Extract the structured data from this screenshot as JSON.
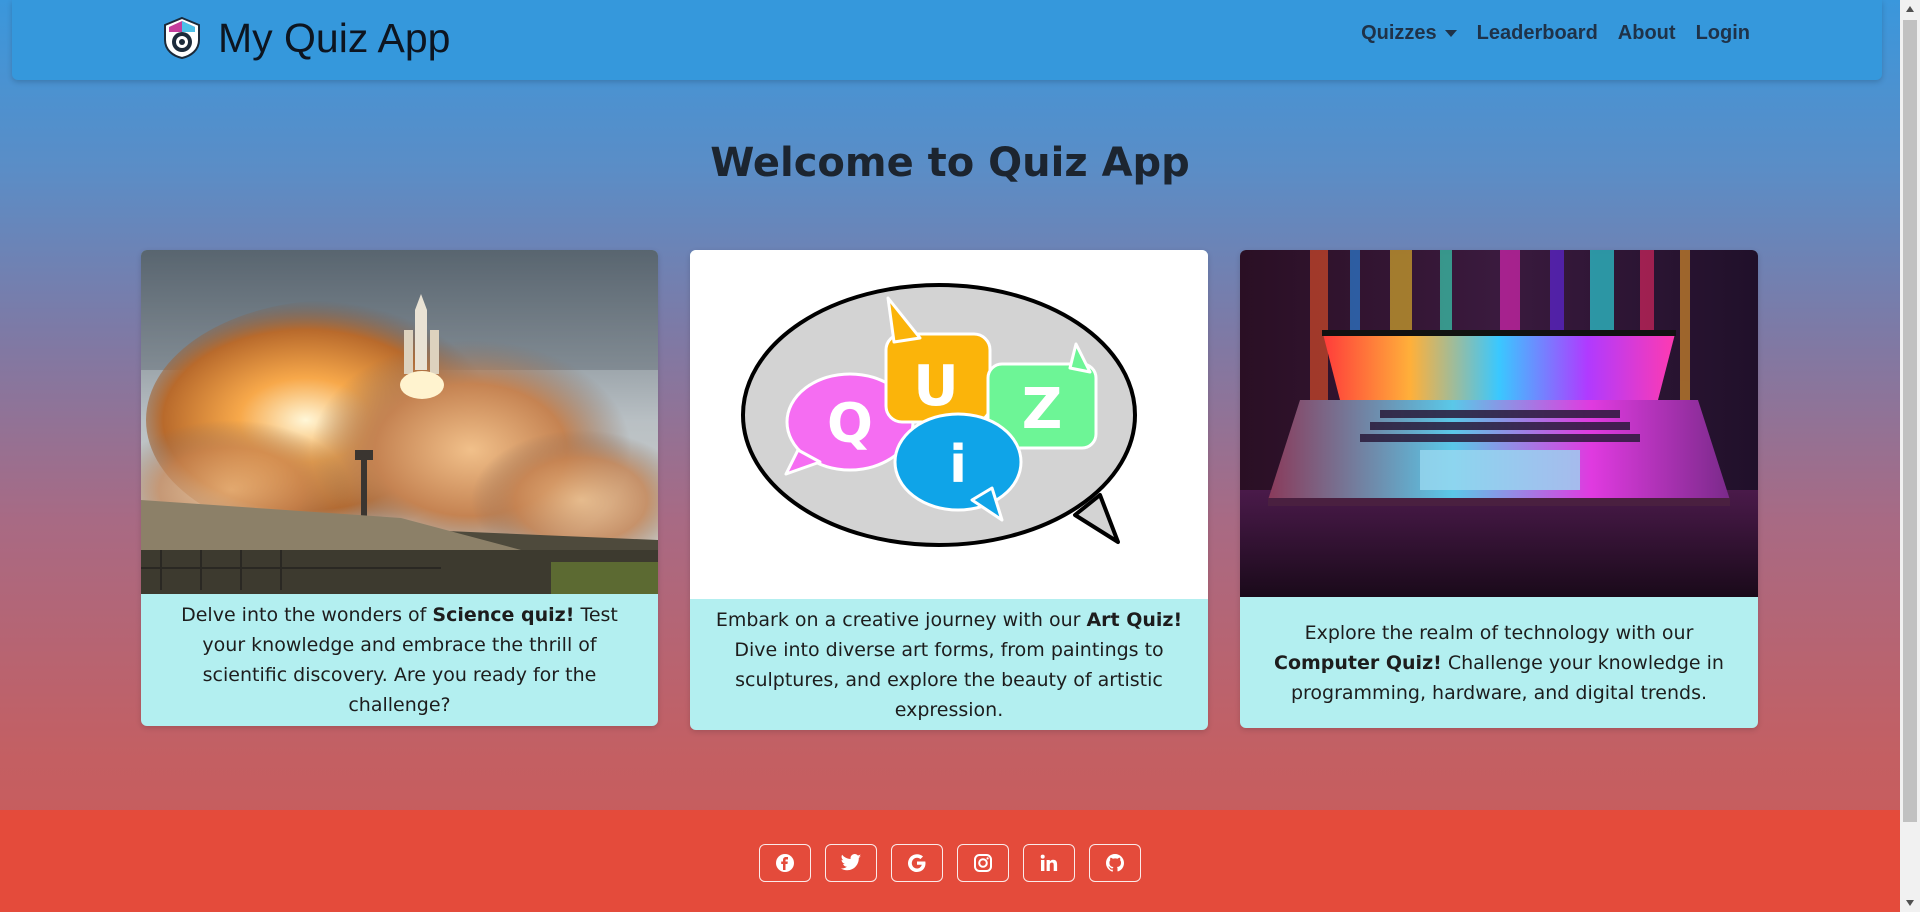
{
  "navbar": {
    "brand": "My Quiz App",
    "links": [
      "Quizzes",
      "Leaderboard",
      "About",
      "Login"
    ]
  },
  "main": {
    "title": "Welcome to Quiz App",
    "cards": [
      {
        "before": "Delve into the wonders of ",
        "bold": "Science quiz!",
        "after": " Test your knowledge and embrace the thrill of scientific discovery. Are you ready for the challenge?"
      },
      {
        "before": "Embark on a creative journey with our ",
        "bold": "Art Quiz!",
        "after": " Dive into diverse art forms, from paintings to sculptures, and explore the beauty of artistic expression."
      },
      {
        "before": "Explore the realm of technology with our ",
        "bold": "Computer Quiz!",
        "after": " Challenge your knowledge in programming, hardware, and digital trends."
      }
    ]
  },
  "footer": {
    "social": [
      "facebook-icon",
      "twitter-icon",
      "google-icon",
      "instagram-icon",
      "linkedin-icon",
      "github-icon"
    ]
  },
  "colors": {
    "navbar": "#3598dc",
    "footer": "#e44b3b",
    "card": "#b3eff0"
  }
}
